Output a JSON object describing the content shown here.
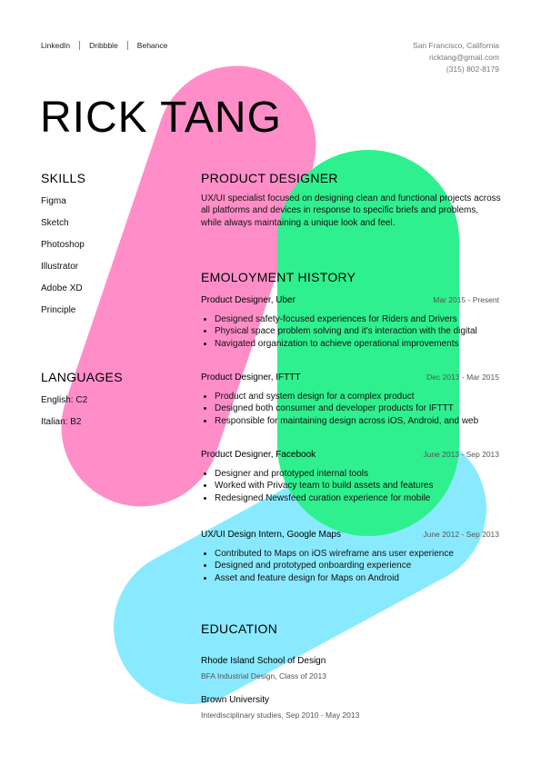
{
  "header": {
    "links": [
      "LinkedIn",
      "Dribbble",
      "Behance"
    ],
    "location": "San Francisco, California",
    "email": "ricktang@gmail.com",
    "phone": "(315) 802-8179",
    "name": "RICK TANG"
  },
  "skills": {
    "title": "SKILLS",
    "items": [
      "Figma",
      "Sketch",
      "Photoshop",
      "Illustrator",
      "Adobe XD",
      "Principle"
    ]
  },
  "languages": {
    "title": "LANGUAGES",
    "items": [
      "English: C2",
      "Italian: B2"
    ]
  },
  "summary": {
    "title": "PRODUCT DESIGNER",
    "text": "UX/UI specialist focused on designing clean and functional projects across all platforms and devices in response to specific briefs and problems, while always maintaining a unique look and feel."
  },
  "employment": {
    "title": "EMOLOYMENT HISTORY",
    "jobs": [
      {
        "title": "Product Designer, Uber",
        "dates": "Mar 2015 - Present",
        "bullets": [
          "Designed safety-focused experiences for Riders and Drivers",
          "Physical space problem solving and it's interaction with the digital",
          "Navigated organization to achieve operational improvements"
        ]
      },
      {
        "title": "Product Designer, IFTTT",
        "dates": "Dec 2013 - Mar 2015",
        "bullets": [
          "Product and system design for a complex product",
          "Designed both consumer and developer products for IFTTT",
          "Responsible for maintaining design across iOS, Android, and web"
        ]
      },
      {
        "title": "Product Designer, Facebook",
        "dates": "June 2013 - Sep 2013",
        "bullets": [
          "Designer and prototyped internal tools",
          "Worked with Privacy team to build assets and features",
          "Redesigned Newsfeed curation experience for mobile"
        ]
      },
      {
        "title": "UX/UI Design Intern, Google Maps",
        "dates": "June 2012 - Sep 2013",
        "bullets": [
          "Contributed to Maps on iOS wireframe ans user experience",
          "Designed and prototyped onboarding experience",
          "Asset and feature design for Maps on Android"
        ]
      }
    ]
  },
  "education": {
    "title": "EDUCATION",
    "schools": [
      {
        "name": "Rhode Island School of Design",
        "detail": "BFA Industrial Design, Class of 2013"
      },
      {
        "name": "Brown University",
        "detail": "Interdisciplinary studies, Sep 2010 - May 2013"
      }
    ]
  },
  "colors": {
    "pink": "#ff8ec8",
    "green": "#2ff08e",
    "blue": "#89eaff",
    "text": "#111111",
    "muted": "#777777"
  }
}
